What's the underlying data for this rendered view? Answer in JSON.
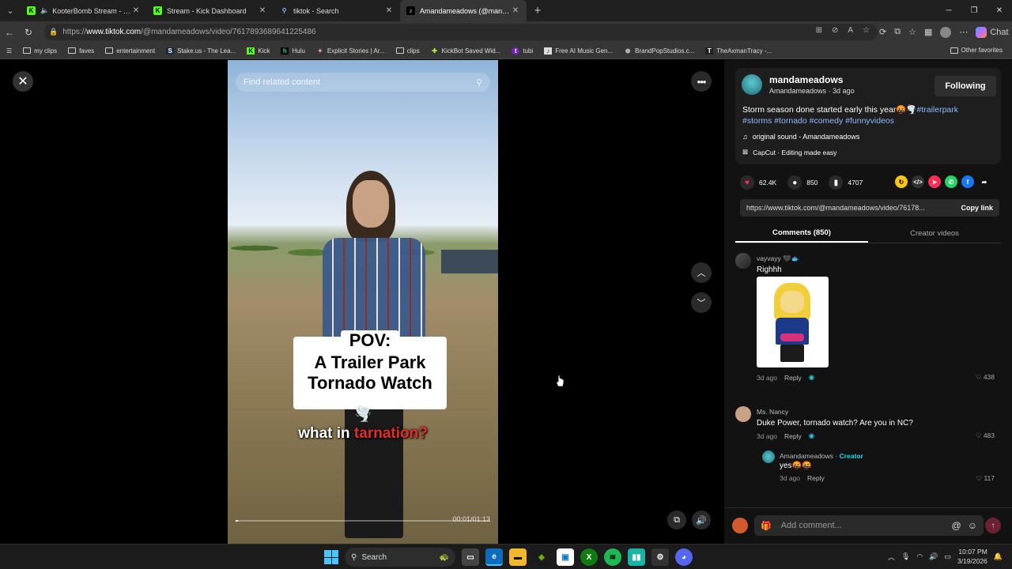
{
  "browser": {
    "tabs": [
      {
        "title": "KooterBomb Stream - Watch",
        "icon": "kick-icon",
        "audio": true
      },
      {
        "title": "Stream - Kick Dashboard",
        "icon": "kick-icon"
      },
      {
        "title": "tiktok - Search",
        "icon": "search-icon"
      },
      {
        "title": "Amandameadows (@mandameadows)",
        "icon": "tiktok-icon",
        "active": true
      }
    ],
    "url_prefix": "https://",
    "url_host": "www.tiktok.com",
    "url_path": "/@mandameadows/video/7617893689641225486",
    "copilot_label": "Chat",
    "bookmarks": [
      {
        "label": "my clips",
        "icon": "folder-icon"
      },
      {
        "label": "faves",
        "icon": "folder-icon"
      },
      {
        "label": "entertainment",
        "icon": "folder-icon"
      },
      {
        "label": "Stake.us - The Lea...",
        "icon": "stake-icon"
      },
      {
        "label": "Kick",
        "icon": "kick-icon"
      },
      {
        "label": "Hulu",
        "icon": "hulu-icon"
      },
      {
        "label": "Explicit Stories | Ar...",
        "icon": "site-icon"
      },
      {
        "label": "clips",
        "icon": "folder-icon"
      },
      {
        "label": "KickBot Saved Wid...",
        "icon": "kickbot-icon"
      },
      {
        "label": "tubi",
        "icon": "tubi-icon"
      },
      {
        "label": "Free AI Music Gen...",
        "icon": "site-icon"
      },
      {
        "label": "BrandPopStudios.c...",
        "icon": "globe-icon"
      },
      {
        "label": "TheAxmanTracy -...",
        "icon": "site-icon"
      }
    ],
    "other_favorites": "Other favorites"
  },
  "video": {
    "search_placeholder": "Find related content",
    "caption_line1": "POV:",
    "caption_line2": "A Trailer Park",
    "caption_line3": "Tornado Watch",
    "caption_emoji": "🌪️",
    "subtitle_a": "what in ",
    "subtitle_b": "tarnation?",
    "timecode": "00:01/01:13",
    "progress": 0.01
  },
  "post": {
    "handle": "mandameadows",
    "display_name": "Amandameadows",
    "age": "3d ago",
    "follow_label": "Following",
    "description_text": "Storm season done started early this year🤬🌪️",
    "hashtags_line1": "#trailerpark",
    "hashtags_line2": "#storms #tornado #comedy #funnyvideos",
    "sound": "original sound - Amandameadows",
    "capcut": "CapCut · Editing made easy",
    "likes": "62.4K",
    "comments_count": "850",
    "saves": "4707",
    "link": "https://www.tiktok.com/@mandameadows/video/76178...",
    "copy_label": "Copy link"
  },
  "panel_tabs": {
    "comments": "Comments (850)",
    "creator_videos": "Creator videos"
  },
  "comments": [
    {
      "user": "vayvayy 🖤🐟",
      "text": "Righhh",
      "time": "3d ago",
      "reply": "Reply",
      "likes": "438",
      "has_sticker": true
    },
    {
      "user": "Ms. Nancy",
      "text": "Duke Power, tornado watch? Are you in NC?",
      "time": "3d ago",
      "reply": "Reply",
      "likes": "483"
    },
    {
      "user": "Amandameadows",
      "creator_label": "Creator",
      "text": "yes🤬🤬",
      "time": "3d ago",
      "reply": "Reply",
      "likes": "117"
    }
  ],
  "add_comment_placeholder": "Add comment...",
  "taskbar": {
    "search_label": "Search",
    "time": "10:07 PM",
    "date": "3/19/2026"
  },
  "colors": {
    "tiktok_red": "#fe2c55",
    "creator_cyan": "#20d5ec",
    "hashtag_blue": "#8fb8ff"
  }
}
